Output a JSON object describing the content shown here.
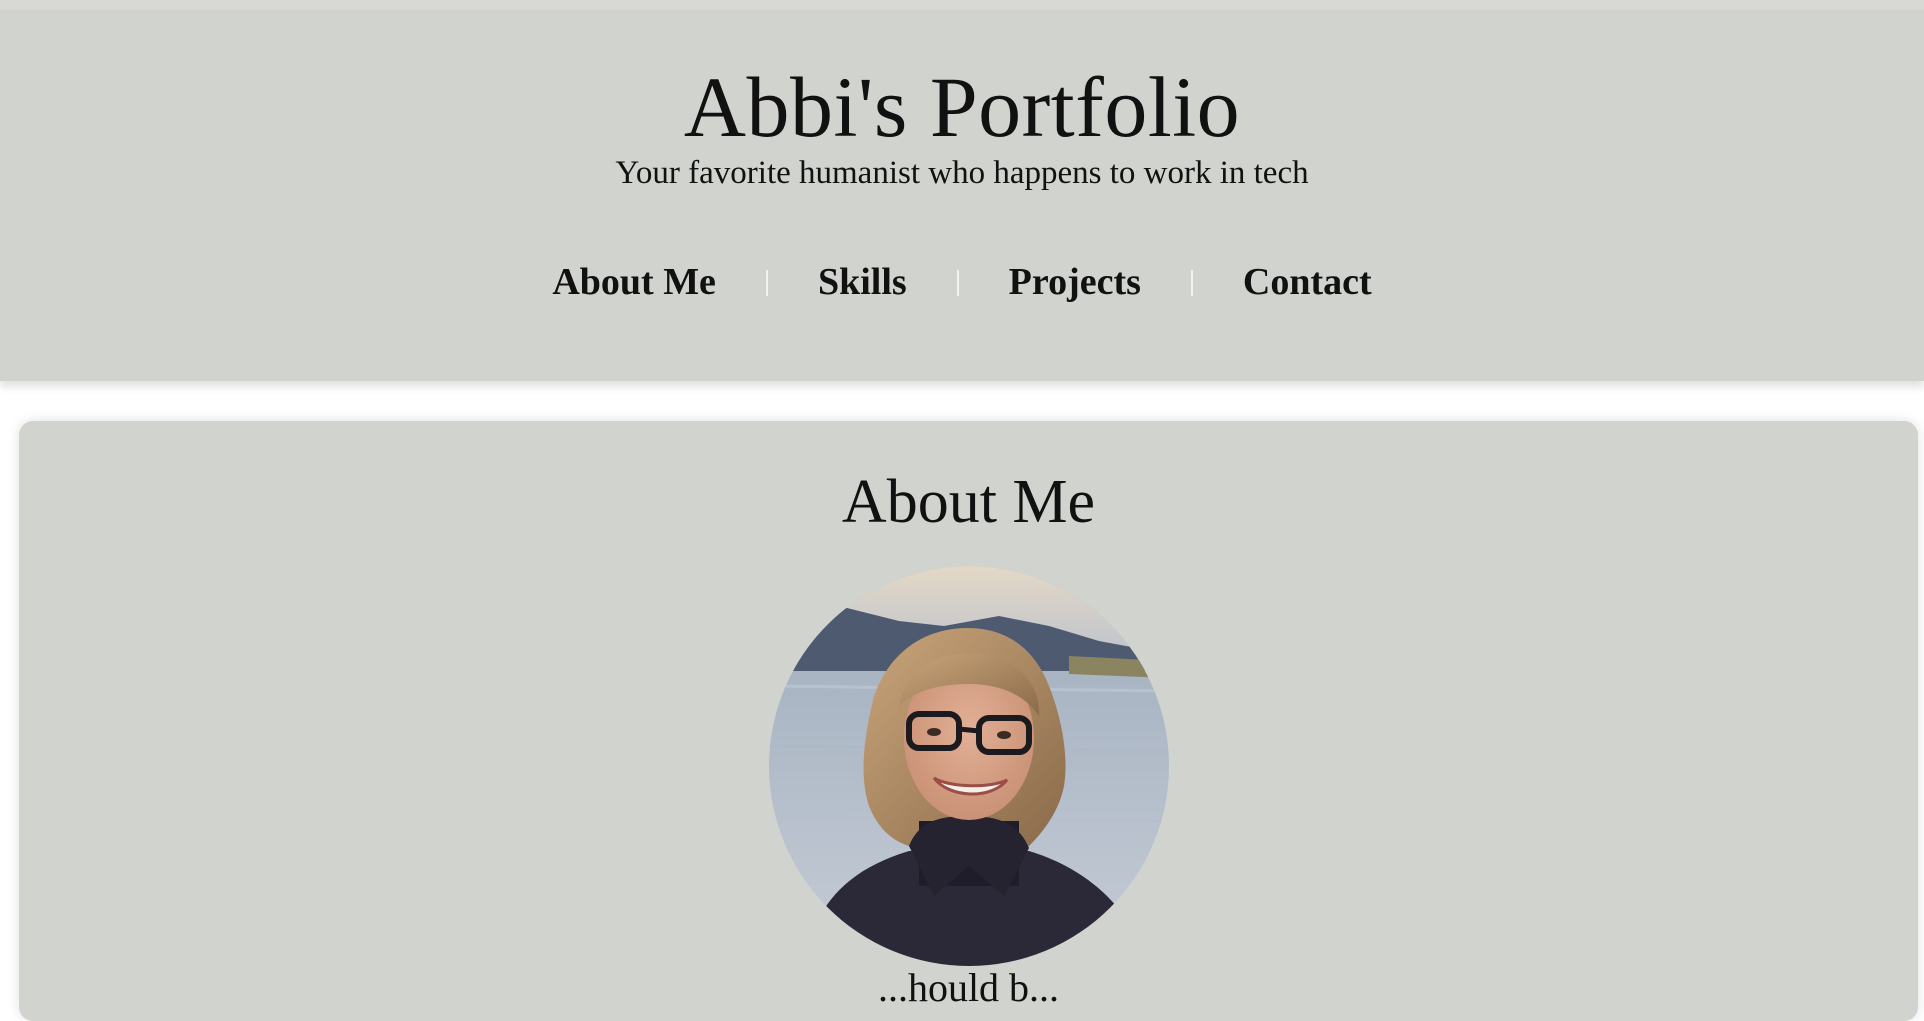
{
  "header": {
    "title": "Abbi's Portfolio",
    "tagline": "Your favorite humanist who happens to work in tech"
  },
  "nav": {
    "items": [
      {
        "label": "About Me"
      },
      {
        "label": "Skills"
      },
      {
        "label": "Projects"
      },
      {
        "label": "Contact"
      }
    ]
  },
  "about": {
    "heading": "About Me",
    "photo_alt": "Photo of Abbi",
    "text_partial": "...hould b..."
  },
  "colors": {
    "page_background": "#ffffff",
    "panel_background": "#d1d3ce",
    "text": "#111111",
    "nav_separator": "#f2f2f0"
  }
}
